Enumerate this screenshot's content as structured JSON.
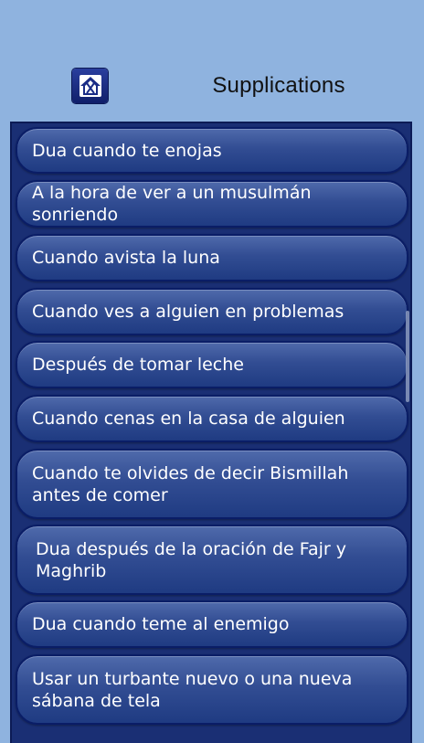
{
  "header": {
    "title": "Supplications",
    "home_icon": "home-icon"
  },
  "list": {
    "items": [
      "Dua cuando te enojas",
      "A la hora de ver a un musulmán sonriendo",
      "Cuando avista la luna",
      "Cuando ves a alguien en problemas",
      "Después de tomar leche",
      "Cuando cenas en la casa de alguien",
      "Cuando te olvides de decir Bismillah antes de comer",
      "Dua después de la oración de Fajr y Maghrib",
      "Dua cuando teme al enemigo",
      "Usar un turbante nuevo o una nueva sábana de tela"
    ]
  },
  "colors": {
    "background": "#8fb3df",
    "list_frame": "#1a2f74",
    "item_top": "#4f6aab",
    "item_bottom": "#1f3b82",
    "item_text": "#ffffff"
  }
}
